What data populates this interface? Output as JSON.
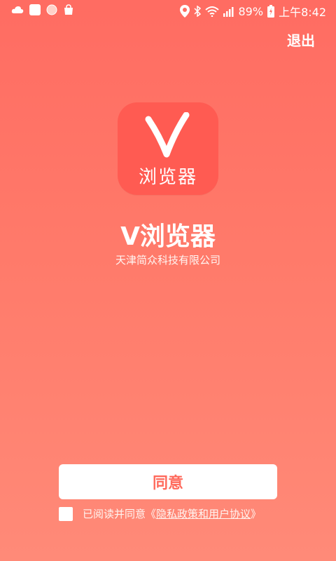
{
  "statusbar": {
    "battery": "89%",
    "time": "上午8:42",
    "left_icons": [
      "cloud-icon",
      "notification-square-icon",
      "circle-icon",
      "shopping-bag-icon"
    ],
    "right_icons": [
      "location-icon",
      "bluetooth-icon",
      "wifi-icon",
      "signal-icon",
      "battery-icon"
    ]
  },
  "header": {
    "exit_label": "退出"
  },
  "app": {
    "icon_letter": "V",
    "icon_text": "浏览器",
    "name": "V浏览器",
    "company": "天津简众科技有限公司",
    "icon_color": "#ff5b52"
  },
  "actions": {
    "agree_label": "同意"
  },
  "agreement": {
    "prefix": "已阅读并同意",
    "open_quote": "《",
    "link_text": "隐私政策和用户协议",
    "close_quote": "》"
  },
  "colors": {
    "background_top": "#ff6c62",
    "background_bottom": "#ff8a78",
    "button_text": "#ff6a5c"
  }
}
